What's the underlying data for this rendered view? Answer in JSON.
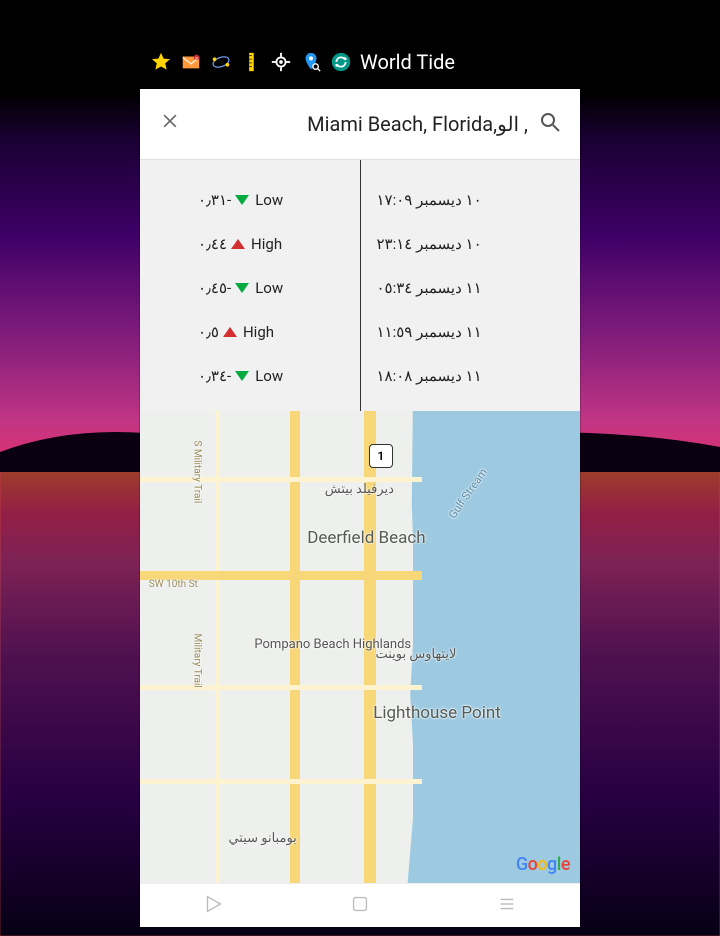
{
  "statusbar": {
    "title": "World Tide"
  },
  "search": {
    "location_text": ", الو,Miami Beach, Florida"
  },
  "tides": [
    {
      "value": "٠٫٣١-",
      "dir": "down",
      "label": "Low",
      "datetime": "١٠ ديسمبر ١٧:٠٩"
    },
    {
      "value": "٠٫٤٤",
      "dir": "up",
      "label": "High",
      "datetime": "١٠ ديسمبر ٢٣:١٤"
    },
    {
      "value": "٠٫٤٥-",
      "dir": "down",
      "label": "Low",
      "datetime": "١١ ديسمبر ٠٥:٣٤"
    },
    {
      "value": "٠٫٥",
      "dir": "up",
      "label": "High",
      "datetime": "١١ ديسمبر ١١:٥٩"
    },
    {
      "value": "٠٫٣٤-",
      "dir": "down",
      "label": "Low",
      "datetime": "١١ ديسمبر ١٨:٠٨"
    }
  ],
  "map": {
    "route_shield": "1",
    "labels": {
      "deerfield_ar": "ديرفيلد بيتش",
      "deerfield_en": "Deerfield Beach",
      "pompano_hl": "Pompano Beach Highlands",
      "lighthouse_ar": "لايتهاوس بوينت",
      "lighthouse_en": "Lighthouse Point",
      "pompano_ar": "بومبانو سيتي",
      "gulf_stream": "Gulf Stream",
      "military_trail_1": "S Military Trail",
      "military_trail_2": "Military Trail",
      "sw10th": "SW 10th St"
    },
    "attribution": "Google"
  }
}
